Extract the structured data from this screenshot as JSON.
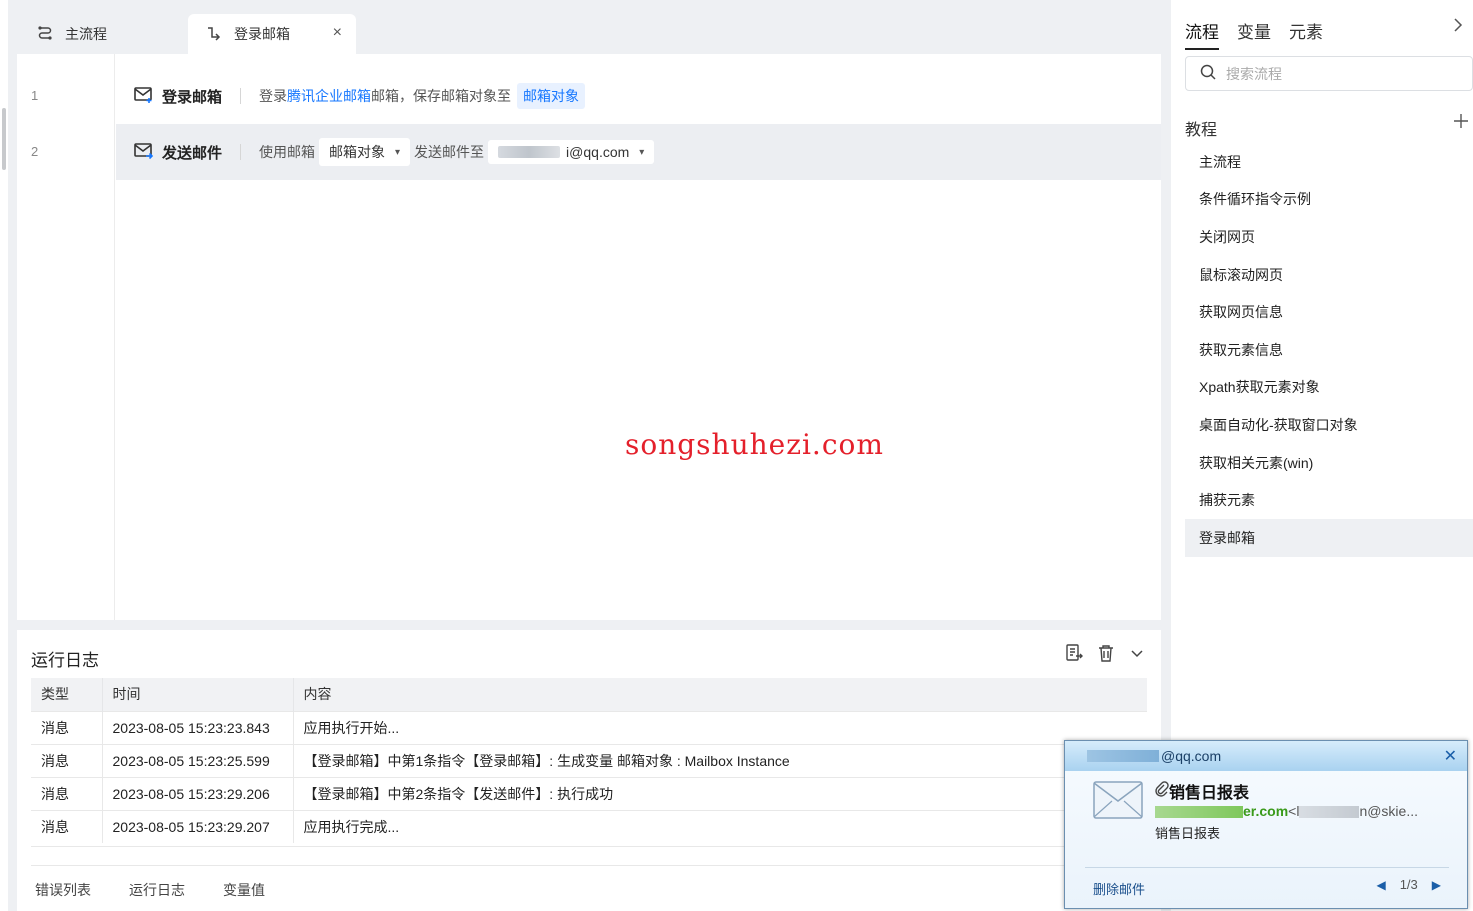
{
  "tabs": {
    "main_label": "主流程",
    "active_label": "登录邮箱",
    "close_glyph": "×"
  },
  "editor": {
    "rows": [
      {
        "line": "1",
        "command": "登录邮箱",
        "desc_prefix": "登录",
        "desc_link": "腾讯企业邮箱",
        "desc_suffix": "邮箱，保存邮箱对象至",
        "chip": "邮箱对象"
      },
      {
        "line": "2",
        "command": "发送邮件",
        "use_label": "使用邮箱",
        "mailbox_select": "邮箱对象",
        "send_to_label": "发送邮件至",
        "recipient_visible": "i@qq.com"
      }
    ],
    "watermark": "songshuhezi.com"
  },
  "log": {
    "title": "运行日志",
    "columns": [
      "类型",
      "时间",
      "内容"
    ],
    "rows": [
      [
        "消息",
        "2023-08-05 15:23:23.843",
        "应用执行开始..."
      ],
      [
        "消息",
        "2023-08-05 15:23:25.599",
        "【登录邮箱】中第1条指令【登录邮箱】: 生成变量 邮箱对象 : Mailbox Instance"
      ],
      [
        "消息",
        "2023-08-05 15:23:29.206",
        "【登录邮箱】中第2条指令【发送邮件】: 执行成功"
      ],
      [
        "消息",
        "2023-08-05 15:23:29.207",
        "应用执行完成..."
      ]
    ],
    "footer_tabs": [
      "错误列表",
      "运行日志",
      "变量值"
    ]
  },
  "right_panel": {
    "tabs": [
      "流程",
      "变量",
      "元素"
    ],
    "search_placeholder": "搜索流程",
    "section_title": "教程",
    "flows": [
      "主流程",
      "条件循环指令示例",
      "关闭网页",
      "鼠标滚动网页",
      "获取网页信息",
      "获取元素信息",
      "Xpath获取元素对象",
      "桌面自动化-获取窗口对象",
      "获取相关元素(win)",
      "捕获元素",
      "登录邮箱"
    ],
    "selected_flow": "登录邮箱"
  },
  "notification": {
    "account_visible": "@qq.com",
    "subject": "销售日报表",
    "sender_domain_visible": "er.com",
    "sender_email_visible": "<l",
    "sender_tail_visible": "n@skie...",
    "body": "销售日报表",
    "delete_label": "删除邮件",
    "pager": "1/3"
  },
  "colors": {
    "accent": "#1677ff",
    "watermark": "#e4202b",
    "selection_bg": "#eceef2"
  }
}
